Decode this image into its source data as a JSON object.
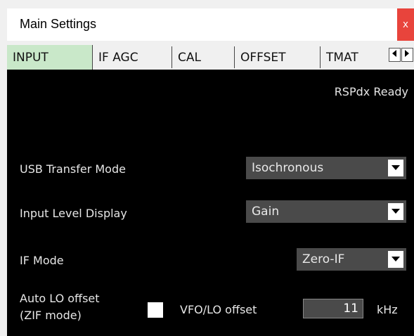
{
  "window": {
    "title": "Main Settings",
    "close_label": "x"
  },
  "tabs": [
    {
      "label": "INPUT",
      "active": true
    },
    {
      "label": "IF AGC",
      "active": false
    },
    {
      "label": "CAL",
      "active": false
    },
    {
      "label": "OFFSET",
      "active": false
    },
    {
      "label": "TMAT",
      "active": false
    }
  ],
  "tab_scroll": {
    "left_icon": "arrow-left-icon",
    "right_icon": "arrow-right-icon"
  },
  "status": "RSPdx Ready",
  "settings": {
    "usb_transfer": {
      "label": "USB Transfer Mode",
      "value": "Isochronous"
    },
    "input_level": {
      "label": "Input Level Display",
      "value": "Gain"
    },
    "if_mode": {
      "label": "IF Mode",
      "value": "Zero-IF"
    },
    "auto_lo": {
      "label_line1": "Auto LO offset",
      "label_line2": "(ZIF mode)",
      "checked": false
    },
    "vfo_lo": {
      "label": "VFO/LO offset",
      "value": "11",
      "unit": "kHz"
    }
  },
  "colors": {
    "panel_bg": "#000000",
    "active_tab": "#c9e8c9",
    "close_bg": "#e8443c",
    "combo_bg": "#4a4a4a"
  }
}
